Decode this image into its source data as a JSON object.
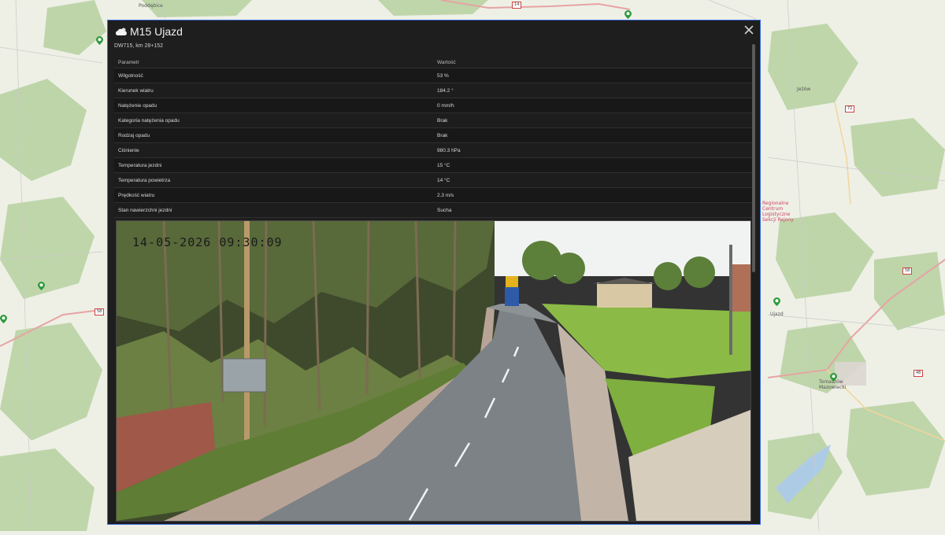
{
  "map": {
    "labels": [
      "Poddębice",
      "Jeżów",
      "Ujazd",
      "Tomaszów Mazowiecki",
      "Regionalne Centrum Logistyczne Sekcji Rejony"
    ],
    "road_numbers": [
      "14",
      "72",
      "58",
      "48"
    ]
  },
  "modal": {
    "title": "M15 Ujazd",
    "subtitle": "DW715, km 28+152",
    "icon": "cloud-sun-icon",
    "close_icon": "close-icon",
    "table": {
      "headers": [
        "Parametr",
        "Wartość"
      ],
      "rows": [
        {
          "param": "Wilgotność",
          "value": "53 %"
        },
        {
          "param": "Kierunek wiatru",
          "value": "184.2 °"
        },
        {
          "param": "Natężenie opadu",
          "value": "0 mm/h"
        },
        {
          "param": "Kategoria natężenia opadu",
          "value": "Brak"
        },
        {
          "param": "Rodzaj opadu",
          "value": "Brak"
        },
        {
          "param": "Ciśnienie",
          "value": "980.3 hPa"
        },
        {
          "param": "Temperatura jezdni",
          "value": "15 °C"
        },
        {
          "param": "Temperatura powietrza",
          "value": "14 °C"
        },
        {
          "param": "Prędkość wiatru",
          "value": "2.3 m/s"
        },
        {
          "param": "Stan nawierzchni jezdni",
          "value": "Sucha"
        }
      ]
    },
    "camera": {
      "timestamp": "14-05-2026 09:30:09"
    }
  }
}
